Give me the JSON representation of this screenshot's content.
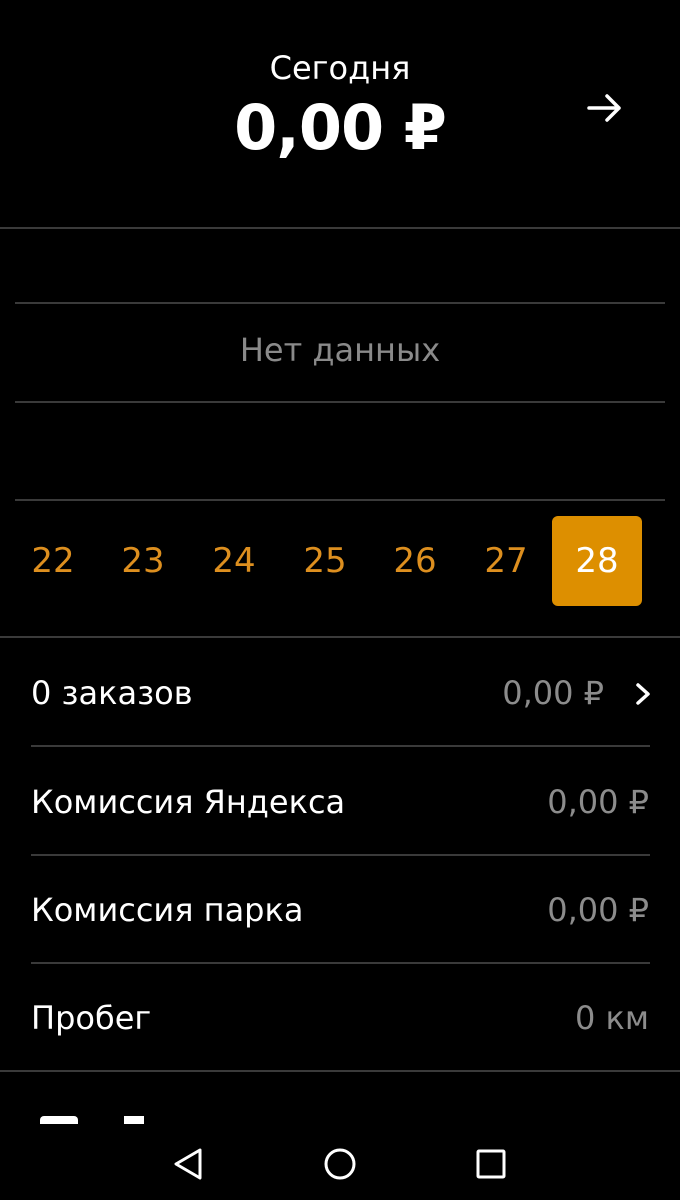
{
  "header": {
    "label": "Сегодня",
    "amount": "0,00 ₽"
  },
  "chart": {
    "empty_text": "Нет данных"
  },
  "days": {
    "items": [
      "22",
      "23",
      "24",
      "25",
      "26",
      "27",
      "28"
    ],
    "selected": "28"
  },
  "summary": {
    "orders_label": "0 заказов",
    "orders_value": "0,00 ₽",
    "yandex_commission_label": "Комиссия Яндекса",
    "yandex_commission_value": "0,00 ₽",
    "park_commission_label": "Комиссия парка",
    "park_commission_value": "0,00 ₽",
    "mileage_label": "Пробег",
    "mileage_value": "0 км"
  },
  "colors": {
    "accent": "#dd8f00",
    "background": "#000000",
    "muted_text": "#8c8c8c",
    "divider": "#3a3a3a"
  },
  "icons": {
    "header_action": "arrow-right-icon",
    "orders_action": "chevron-right-icon",
    "nav_back": "back-triangle-icon",
    "nav_home": "home-circle-icon",
    "nav_recents": "recents-square-icon"
  }
}
